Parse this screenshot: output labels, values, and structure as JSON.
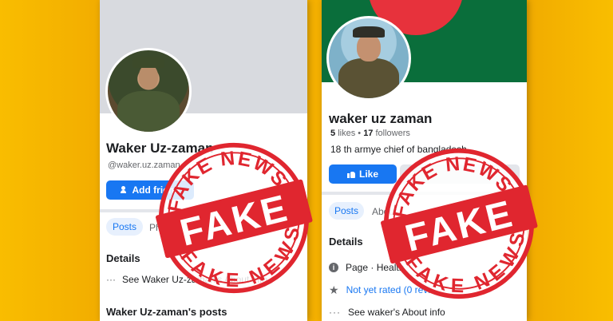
{
  "left_profile": {
    "name": "Waker Uz-zaman",
    "handle": "@waker.uz.zaman",
    "add_friend_label": "Add friend",
    "tabs": {
      "posts": "Posts",
      "photos": "Phot"
    },
    "details_heading": "Details",
    "about_link": "See Waker Uz-zaman's About info",
    "posts_heading": "Waker Uz-zaman's posts"
  },
  "right_profile": {
    "name": "waker uz zaman",
    "likes_count": "5",
    "likes_label": "likes",
    "followers_count": "17",
    "followers_label": "followers",
    "bio": "18 th armye chief of bangladesh",
    "like_label": "Like",
    "tabs": {
      "posts": "Posts",
      "about": "About"
    },
    "details_heading": "Details",
    "category": "Page · Health",
    "rating": "Not yet rated (0 revi",
    "about_link": "See waker's About info"
  },
  "stamp": {
    "top_text": "FAKE NEWS",
    "main_text": "FAKE",
    "bottom_text": "FAKE NEWS"
  },
  "colors": {
    "background": "#f7b500",
    "facebook_blue": "#1877f2",
    "stamp_red": "#e0262f",
    "flag_green": "#0a6e3b",
    "flag_red": "#e7323c"
  }
}
